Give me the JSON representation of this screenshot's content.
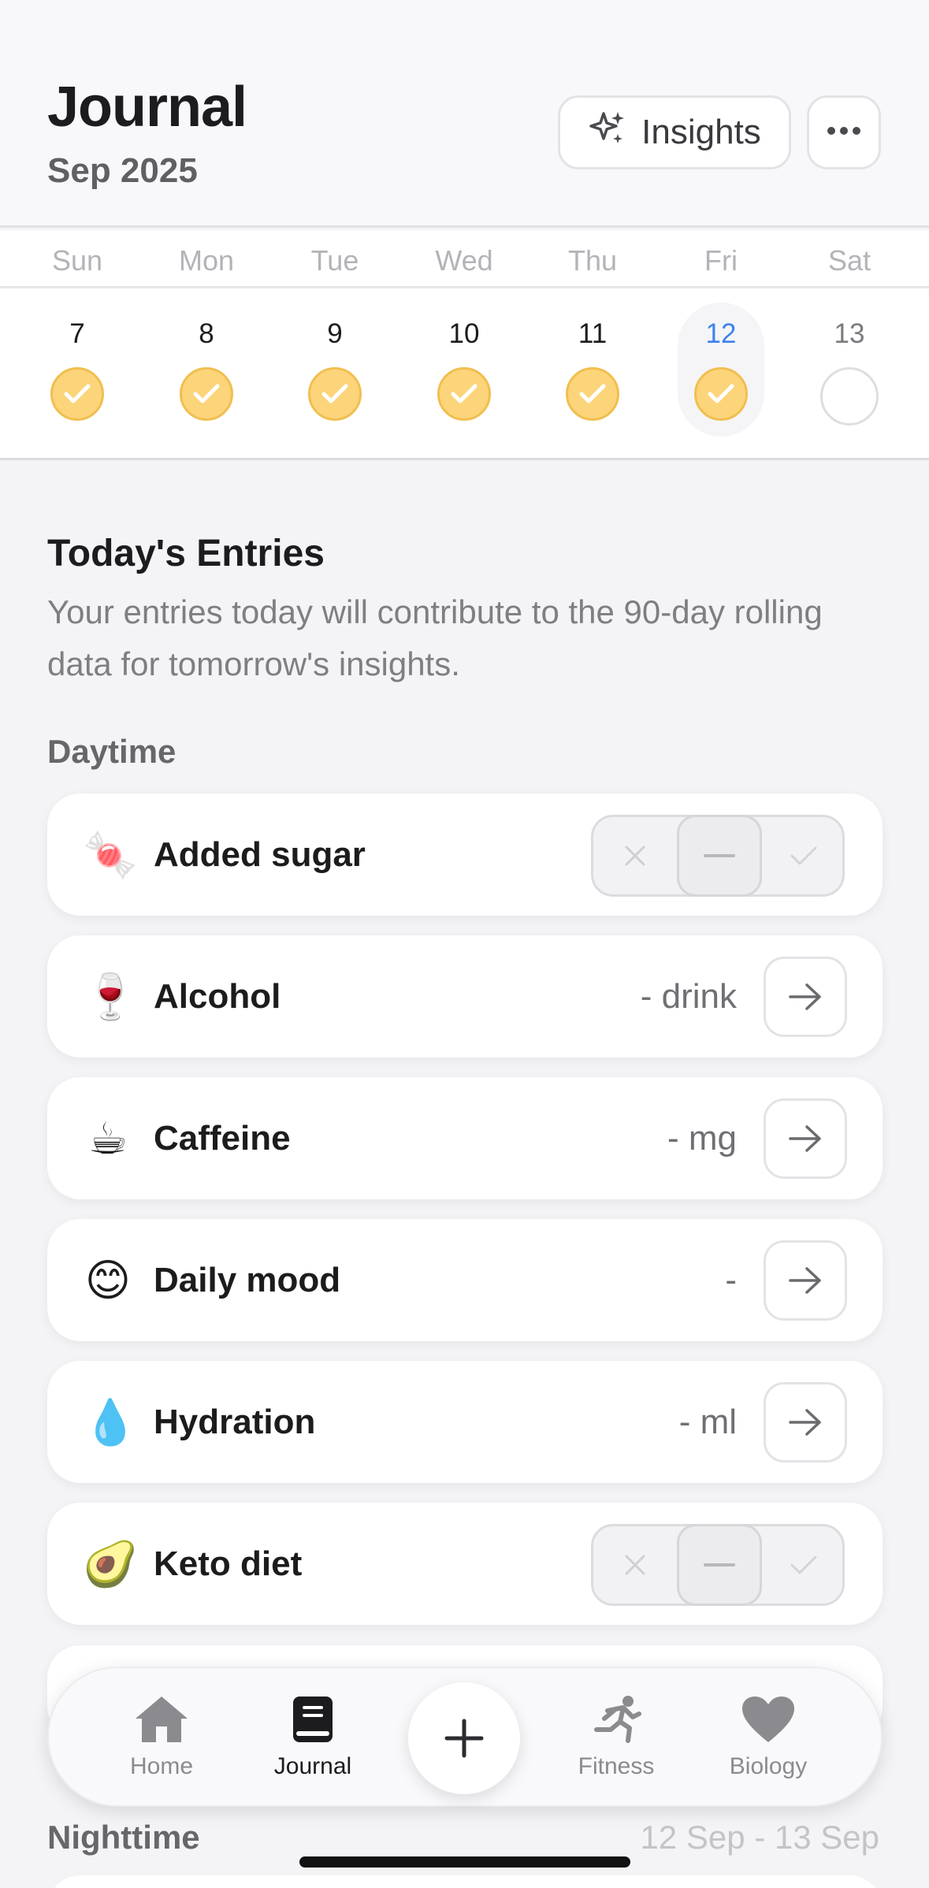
{
  "header": {
    "title": "Journal",
    "subtitle": "Sep 2025",
    "insights_label": "Insights",
    "insights_icon": "sparkles-icon",
    "more_icon": "ellipsis-icon"
  },
  "week": {
    "day_names": [
      "Sun",
      "Mon",
      "Tue",
      "Wed",
      "Thu",
      "Fri",
      "Sat"
    ],
    "days": [
      {
        "num": "7",
        "status": "complete"
      },
      {
        "num": "8",
        "status": "complete"
      },
      {
        "num": "9",
        "status": "complete"
      },
      {
        "num": "10",
        "status": "complete"
      },
      {
        "num": "11",
        "status": "complete"
      },
      {
        "num": "12",
        "status": "complete",
        "selected": true
      },
      {
        "num": "13",
        "status": "empty"
      }
    ],
    "accent": "#3c82f0",
    "complete_color": "#fcd47a"
  },
  "today": {
    "title": "Today's Entries",
    "description": "Your entries today will contribute to the 90-day rolling data for tomorrow's insights."
  },
  "daytime": {
    "label": "Daytime",
    "entries": [
      {
        "emoji": "🍬",
        "name": "Added sugar",
        "control": "segmented"
      },
      {
        "emoji": "🍷",
        "name": "Alcohol",
        "value": "- drink",
        "control": "arrow"
      },
      {
        "emoji": "☕",
        "name": "Caffeine",
        "value": "- mg",
        "control": "arrow"
      },
      {
        "emoji": "😊",
        "name": "Daily mood",
        "value": "-",
        "control": "arrow"
      },
      {
        "emoji": "💧",
        "name": "Hydration",
        "value": "- ml",
        "control": "arrow"
      },
      {
        "emoji": "🥑",
        "name": "Keto diet",
        "control": "segmented"
      }
    ]
  },
  "nighttime": {
    "label": "Nighttime",
    "range": "12 Sep - 13 Sep"
  },
  "tabbar": {
    "home": "Home",
    "journal": "Journal",
    "fitness": "Fitness",
    "biology": "Biology",
    "active": "journal"
  }
}
